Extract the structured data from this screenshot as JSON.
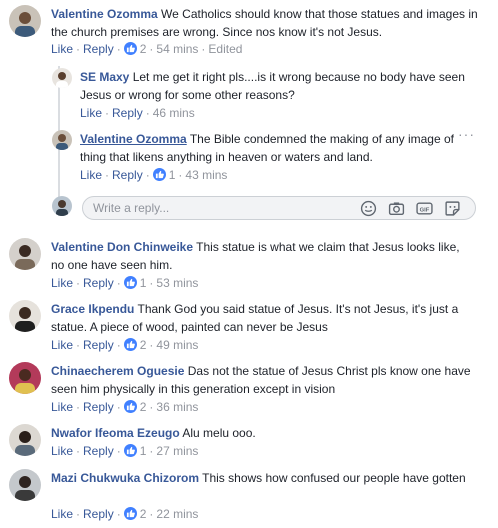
{
  "comments": [
    {
      "author": "Valentine Ozomma",
      "text": "We Catholics should know that those statues and images in the church premises are wrong. Since nos know it's not Jesus.",
      "like_label": "Like",
      "reply_label": "Reply",
      "likes": "2",
      "time": "54 mins",
      "extra": "Edited"
    },
    {
      "author": "SE Maxy",
      "text": "Let me get it right pls....is it wrong because no body have seen Jesus or wrong for some other reasons?",
      "like_label": "Like",
      "reply_label": "Reply",
      "time": "46 mins"
    },
    {
      "author": "Valentine Ozomma",
      "text": "The Bible condemned the making of any image of thing that likens anything in heaven or waters and land.",
      "like_label": "Like",
      "reply_label": "Reply",
      "likes": "1",
      "time": "43 mins"
    },
    {
      "author": "Valentine Don Chinweike",
      "text": "This statue is what we claim that Jesus looks like, no one have seen him.",
      "like_label": "Like",
      "reply_label": "Reply",
      "likes": "1",
      "time": "53 mins"
    },
    {
      "author": "Grace Ikpendu",
      "text": "Thank God you said statue of Jesus. It's not Jesus, it's just a statue. A piece of wood, painted can never be Jesus",
      "like_label": "Like",
      "reply_label": "Reply",
      "likes": "2",
      "time": "49 mins"
    },
    {
      "author": "Chinaecherem Oguesie",
      "text": "Das not the statue of Jesus Christ pls know one have seen him physically in this generation except in vision",
      "like_label": "Like",
      "reply_label": "Reply",
      "likes": "2",
      "time": "36 mins"
    },
    {
      "author": "Nwafor Ifeoma Ezeugo",
      "text": "Alu melu ooo.",
      "like_label": "Like",
      "reply_label": "Reply",
      "likes": "1",
      "time": "27 mins"
    },
    {
      "author": "Mazi Chukwuka Chizorom",
      "text": "This shows how confused our people have gotten",
      "like_label": "Like",
      "reply_label": "Reply",
      "likes": "2",
      "time": "22 mins"
    }
  ],
  "reply_box": {
    "placeholder": "Write a reply..."
  },
  "colors": {
    "link": "#385898",
    "meta": "#90949c",
    "like_badge": "#4080ff"
  },
  "icons": [
    "like-icon",
    "emoji-icon",
    "camera-icon",
    "gif-icon",
    "sticker-icon",
    "more-options-icon"
  ]
}
